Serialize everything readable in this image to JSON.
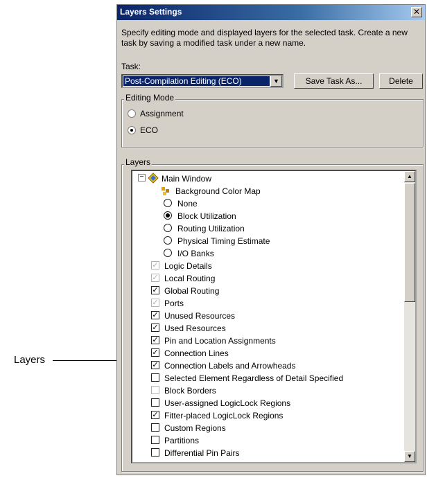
{
  "annotation": {
    "label": "Layers"
  },
  "dialog": {
    "title": "Layers Settings",
    "close_glyph": "✕",
    "description": "Specify editing mode and displayed layers for the selected task. Create a new task by saving a modified task under a new name.",
    "task_label": "Task:",
    "task_value": "Post-Compilation Editing (ECO)",
    "save_task_label": "Save Task As...",
    "delete_label": "Delete",
    "editing_mode": {
      "legend": "Editing Mode",
      "options": [
        {
          "label": "Assignment",
          "selected": false
        },
        {
          "label": "ECO",
          "selected": true
        }
      ]
    },
    "layers": {
      "legend": "Layers",
      "main_window": "Main Window",
      "background_color_map": "Background Color Map",
      "color_map_options": [
        {
          "label": "None",
          "selected": false
        },
        {
          "label": "Block Utilization",
          "selected": true
        },
        {
          "label": "Routing Utilization",
          "selected": false
        },
        {
          "label": "Physical Timing Estimate",
          "selected": false
        },
        {
          "label": "I/O Banks",
          "selected": false
        }
      ],
      "items": [
        {
          "label": "Logic Details",
          "checked": true,
          "dimmed": true
        },
        {
          "label": "Local Routing",
          "checked": true,
          "dimmed": true
        },
        {
          "label": "Global Routing",
          "checked": true,
          "dimmed": false
        },
        {
          "label": "Ports",
          "checked": true,
          "dimmed": true
        },
        {
          "label": "Unused Resources",
          "checked": true,
          "dimmed": false
        },
        {
          "label": "Used Resources",
          "checked": true,
          "dimmed": false
        },
        {
          "label": "Pin and Location Assignments",
          "checked": true,
          "dimmed": false
        },
        {
          "label": "Connection Lines",
          "checked": true,
          "dimmed": false
        },
        {
          "label": "Connection Labels and Arrowheads",
          "checked": true,
          "dimmed": false
        },
        {
          "label": "Selected Element Regardless of Detail Specified",
          "checked": false,
          "dimmed": false
        },
        {
          "label": "Block Borders",
          "checked": false,
          "dimmed": true
        },
        {
          "label": "User-assigned LogicLock Regions",
          "checked": false,
          "dimmed": false
        },
        {
          "label": "Fitter-placed LogicLock Regions",
          "checked": true,
          "dimmed": false
        },
        {
          "label": "Custom Regions",
          "checked": false,
          "dimmed": false
        },
        {
          "label": "Partitions",
          "checked": false,
          "dimmed": false
        },
        {
          "label": "Differential Pin Pairs",
          "checked": false,
          "dimmed": false
        }
      ]
    }
  }
}
